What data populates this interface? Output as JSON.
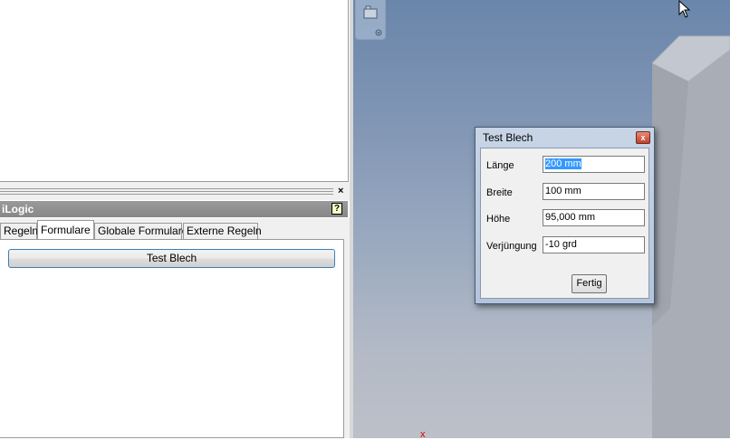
{
  "panel": {
    "header_title": "iLogic",
    "help_symbol": "?",
    "close_symbol": "×",
    "tabs": [
      {
        "label": "Regeln"
      },
      {
        "label": "Formulare"
      },
      {
        "label": "Globale Formulare"
      },
      {
        "label": "Externe Regeln"
      }
    ],
    "form_button_label": "Test Blech"
  },
  "dialog": {
    "title": "Test Blech",
    "close_symbol": "x",
    "fields": [
      {
        "label": "Länge",
        "value": "200 mm"
      },
      {
        "label": "Breite",
        "value": "100 mm"
      },
      {
        "label": "Höhe",
        "value": "95,000 mm"
      },
      {
        "label": "Verjüngung",
        "value": "-10 grd"
      }
    ],
    "done_label": "Fertig"
  },
  "viewport": {
    "axis_label": "x",
    "background_top": "#6a86aa",
    "background_bottom": "#bcc0c8"
  }
}
